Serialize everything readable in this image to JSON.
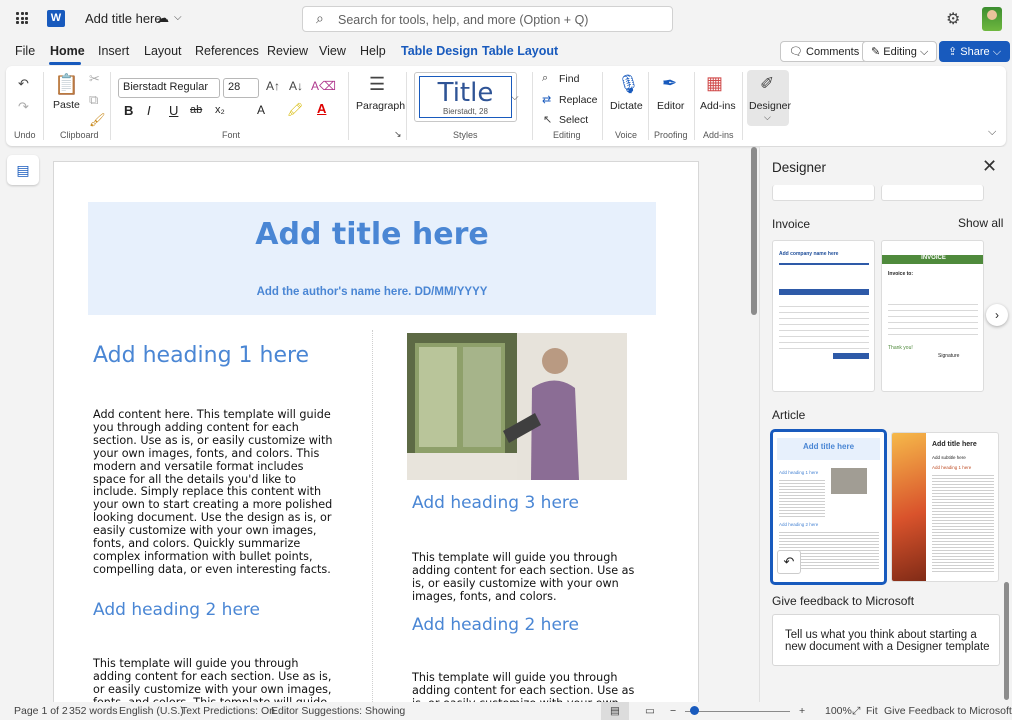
{
  "titlebar": {
    "app": "W",
    "doc_title": "Add title here",
    "search_placeholder": "Search for tools, help, and more (Option + Q)"
  },
  "tabs": [
    "File",
    "Home",
    "Insert",
    "Layout",
    "References",
    "Review",
    "View",
    "Help",
    "Table Design",
    "Table Layout"
  ],
  "tab_actions": {
    "comments": "Comments",
    "editing": "Editing",
    "share": "Share"
  },
  "ribbon": {
    "undo_label": "Undo",
    "paste_label": "Paste",
    "clipboard_label": "Clipboard",
    "font_name": "Bierstadt Regular",
    "font_size": "28",
    "font_label": "Font",
    "bold": "B",
    "italic": "I",
    "underline": "U",
    "strike": "ab",
    "sub": "x₂",
    "shrink": "A",
    "paragraph_label": "Paragraph",
    "style_title": "Title",
    "style_sub": "Bierstadt, 28",
    "styles_label": "Styles",
    "find": "Find",
    "replace": "Replace",
    "select": "Select",
    "editing_label": "Editing",
    "dictate": "Dictate",
    "voice_label": "Voice",
    "editor": "Editor",
    "proofing_label": "Proofing",
    "addins": "Add-ins",
    "addins_label": "Add-ins",
    "designer": "Designer"
  },
  "document": {
    "title": "Add title here",
    "author": "Add the author's name here. DD/MM/YYYY",
    "heading1": "Add heading 1 here",
    "body1": "Add content here. This template will guide you through adding content for each section. Use as is, or easily customize with your own images, fonts, and colors. This modern and versatile format includes space for all the details you'd like to include. Simply replace this content with your own to start creating a more polished looking document. Use the design as is, or easily customize with your own images, fonts, and colors. Quickly summarize complex information with bullet points, compelling data, or even interesting facts.",
    "heading2_left": "Add heading 2 here",
    "body2_left": "This template will guide you through adding content for each section. Use as is, or easily customize with your own images, fonts, and colors. This template will guide you through adding",
    "heading3": "Add heading 3 here",
    "body3": "This template will guide you through adding content for each section. Use as is, or easily customize with your own images, fonts, and colors.",
    "heading2_right": "Add heading 2 here",
    "body4": "This template will guide you through adding content for each section. Use as is, or easily customize with your own images"
  },
  "designer": {
    "title": "Designer",
    "invoice_section": "Invoice",
    "show_all": "Show all",
    "invoice_card1_header": "Add company name here",
    "invoice_card2_header": "INVOICE",
    "invoice_card2_to": "Invoice to:",
    "invoice_card2_thanks": "Thank you!",
    "invoice_card2_sig": "Signature",
    "article_section": "Article",
    "article_card1_title": "Add title here",
    "article_card1_h1": "Add heading 1 here",
    "article_card1_h2": "Add heading 2 here",
    "article_card2_title": "Add title here",
    "article_card2_sub": "Add subtitle here",
    "article_card2_h1": "Add heading 1 here",
    "feedback_title": "Give feedback to Microsoft",
    "feedback_text": "Tell us what you think about starting a new document with a Designer template"
  },
  "status": {
    "page": "Page 1 of 2",
    "words": "352 words",
    "language": "English (U.S.)",
    "predictions": "Text Predictions: On",
    "suggestions": "Editor Suggestions: Showing",
    "zoom": "100%",
    "fit": "Fit",
    "feedback": "Give Feedback to Microsoft"
  },
  "colors": {
    "accent": "#185abd",
    "heading": "#4a86d4",
    "banner": "#e7f0fc"
  }
}
